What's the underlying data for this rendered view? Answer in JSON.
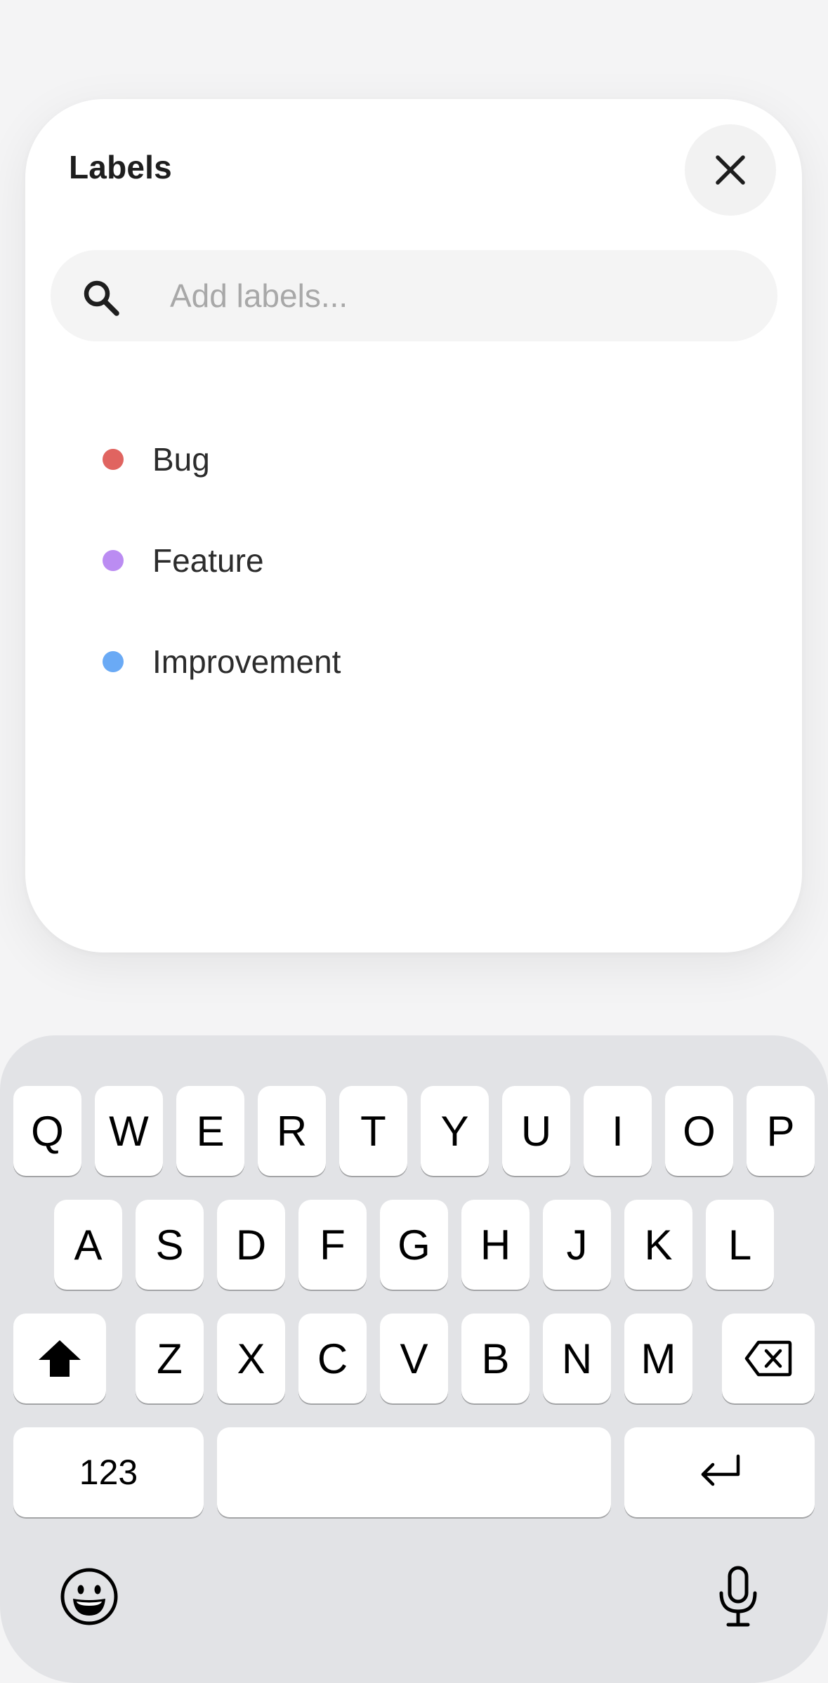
{
  "sheet": {
    "title": "Labels",
    "close_icon": "close-icon",
    "search": {
      "icon": "search-icon",
      "placeholder": "Add labels...",
      "value": ""
    },
    "labels": [
      {
        "name": "Bug",
        "color": "#e06460"
      },
      {
        "name": "Feature",
        "color": "#bb8cf2"
      },
      {
        "name": "Improvement",
        "color": "#6aaaf5"
      }
    ]
  },
  "keyboard": {
    "row1": [
      "Q",
      "W",
      "E",
      "R",
      "T",
      "Y",
      "U",
      "I",
      "O",
      "P"
    ],
    "row2": [
      "A",
      "S",
      "D",
      "F",
      "G",
      "H",
      "J",
      "K",
      "L"
    ],
    "row3": [
      "Z",
      "X",
      "C",
      "V",
      "B",
      "N",
      "M"
    ],
    "shift_icon": "shift-icon",
    "delete_icon": "delete-icon",
    "numbers_label": "123",
    "return_icon": "return-icon",
    "emoji_icon": "emoji-icon",
    "mic_icon": "microphone-icon"
  }
}
